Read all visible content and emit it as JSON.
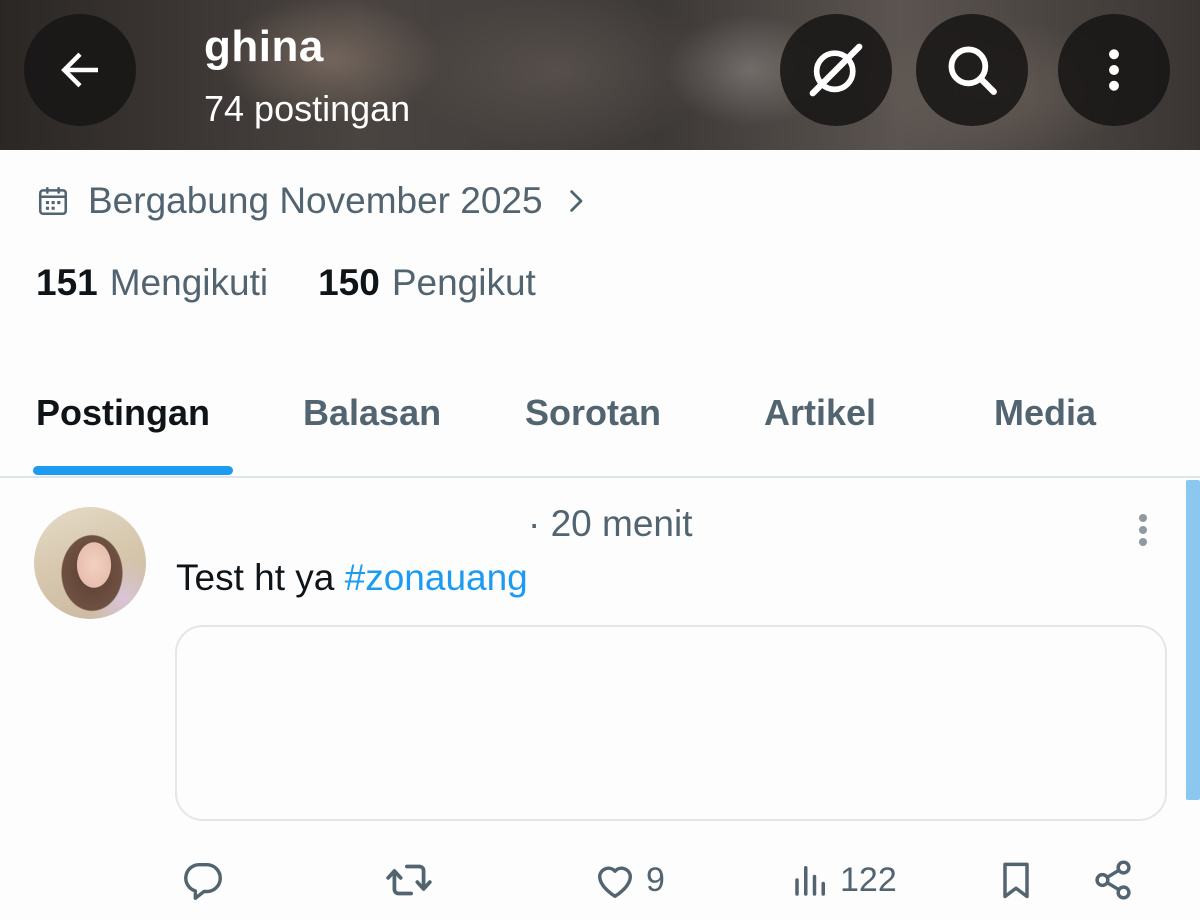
{
  "header": {
    "name": "ghina",
    "posts_count": "74 postingan",
    "buttons": [
      "back-arrow-icon",
      "grok-icon",
      "search-icon",
      "more-vertical-icon"
    ]
  },
  "profile": {
    "joined": "Bergabung November 2025",
    "following_count": "151",
    "following_label": "Mengikuti",
    "followers_count": "150",
    "followers_label": "Pengikut"
  },
  "tabs": [
    {
      "label": "Postingan",
      "active": true
    },
    {
      "label": "Balasan",
      "active": false
    },
    {
      "label": "Sorotan",
      "active": false
    },
    {
      "label": "Artikel",
      "active": false
    },
    {
      "label": "Media",
      "active": false
    }
  ],
  "post": {
    "time": "· 20 menit",
    "text": "Test ht ya",
    "hashtag": "#zonauang",
    "likes": "9",
    "views": "122"
  },
  "colors": {
    "accent": "#1d9bf0",
    "secondary_text": "#536471",
    "primary_text": "#0f1419"
  }
}
